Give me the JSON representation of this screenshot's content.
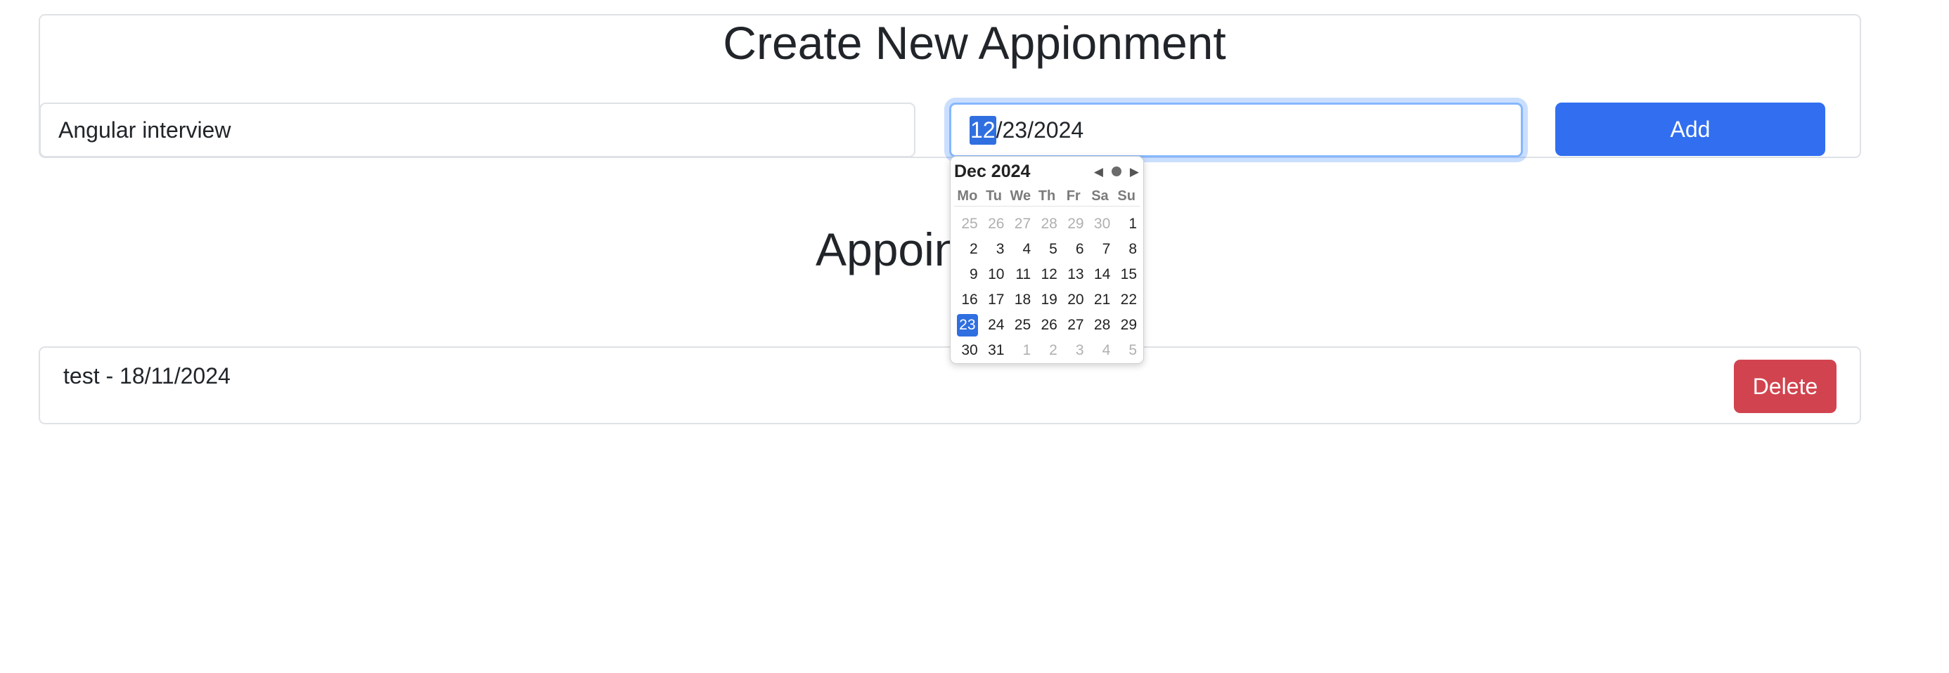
{
  "create": {
    "title": "Create New Appionment",
    "title_input_value": "Angular interview",
    "date": {
      "month": "12",
      "rest": "/23/2024"
    },
    "add_label": "Add"
  },
  "list": {
    "title_visible": "Appoin",
    "items": [
      {
        "text": "test - 18/11/2024",
        "delete_label": "Delete"
      }
    ]
  },
  "datepicker": {
    "month_label": "Dec 2024",
    "prev_icon": "◀",
    "next_icon": "▶",
    "weekdays": [
      "Mo",
      "Tu",
      "We",
      "Th",
      "Fr",
      "Sa",
      "Su"
    ],
    "weeks": [
      [
        {
          "d": "25",
          "o": true
        },
        {
          "d": "26",
          "o": true
        },
        {
          "d": "27",
          "o": true
        },
        {
          "d": "28",
          "o": true
        },
        {
          "d": "29",
          "o": true
        },
        {
          "d": "30",
          "o": true
        },
        {
          "d": "1"
        }
      ],
      [
        {
          "d": "2"
        },
        {
          "d": "3"
        },
        {
          "d": "4"
        },
        {
          "d": "5"
        },
        {
          "d": "6"
        },
        {
          "d": "7"
        },
        {
          "d": "8"
        }
      ],
      [
        {
          "d": "9"
        },
        {
          "d": "10"
        },
        {
          "d": "11"
        },
        {
          "d": "12"
        },
        {
          "d": "13"
        },
        {
          "d": "14"
        },
        {
          "d": "15"
        }
      ],
      [
        {
          "d": "16"
        },
        {
          "d": "17"
        },
        {
          "d": "18"
        },
        {
          "d": "19"
        },
        {
          "d": "20"
        },
        {
          "d": "21"
        },
        {
          "d": "22"
        }
      ],
      [
        {
          "d": "23",
          "s": true
        },
        {
          "d": "24"
        },
        {
          "d": "25"
        },
        {
          "d": "26"
        },
        {
          "d": "27"
        },
        {
          "d": "28"
        },
        {
          "d": "29"
        }
      ],
      [
        {
          "d": "30"
        },
        {
          "d": "31"
        },
        {
          "d": "1",
          "o": true
        },
        {
          "d": "2",
          "o": true
        },
        {
          "d": "3",
          "o": true
        },
        {
          "d": "4",
          "o": true
        },
        {
          "d": "5",
          "o": true
        }
      ]
    ]
  },
  "colors": {
    "primary": "#316ff0",
    "danger": "#d1444f",
    "focus_ring": "#86b7fe",
    "selected_day": "#2f6fe0"
  }
}
